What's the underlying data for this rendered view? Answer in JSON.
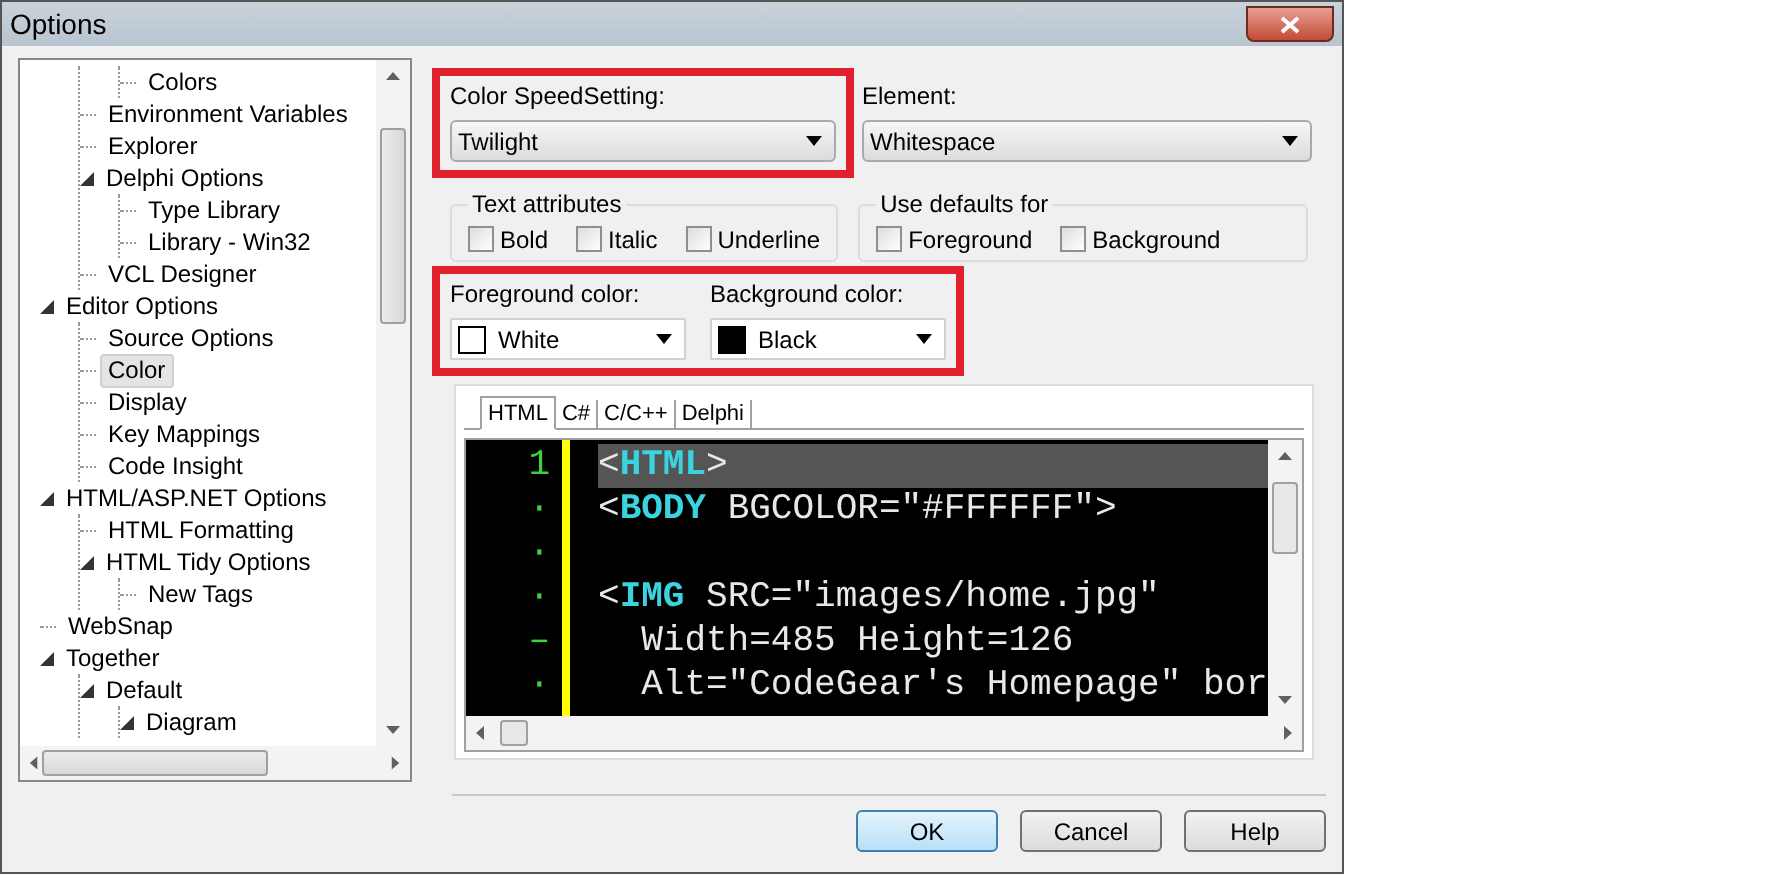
{
  "window": {
    "title": "Options"
  },
  "tree": {
    "items": [
      {
        "children": [
          {
            "children": [
              {
                "label": "Colors",
                "selected": false
              }
            ]
          },
          {
            "label": "Environment Variables",
            "selected": false
          },
          {
            "label": "Explorer",
            "selected": false
          },
          {
            "label": "Delphi Options",
            "selected": false,
            "expanded": true,
            "children": [
              {
                "label": "Type Library",
                "selected": false
              },
              {
                "label": "Library - Win32",
                "selected": false
              }
            ]
          },
          {
            "label": "VCL Designer",
            "selected": false
          }
        ]
      },
      {
        "label": "Editor Options",
        "selected": false,
        "expanded": true,
        "children": [
          {
            "label": "Source Options",
            "selected": false
          },
          {
            "label": "Color",
            "selected": true
          },
          {
            "label": "Display",
            "selected": false
          },
          {
            "label": "Key Mappings",
            "selected": false
          },
          {
            "label": "Code Insight",
            "selected": false
          }
        ]
      },
      {
        "label": "HTML/ASP.NET Options",
        "selected": false,
        "expanded": true,
        "children": [
          {
            "label": "HTML Formatting",
            "selected": false
          },
          {
            "label": "HTML Tidy Options",
            "selected": false,
            "expanded": true,
            "children": [
              {
                "label": "New Tags",
                "selected": false
              }
            ]
          }
        ]
      },
      {
        "label": "WebSnap",
        "selected": false
      },
      {
        "label": "Together",
        "selected": false,
        "expanded": true,
        "children": [
          {
            "label": "Default",
            "selected": false,
            "expanded": true,
            "children": [
              {
                "label": "Diagram",
                "selected": false,
                "expanded": true
              }
            ]
          }
        ]
      }
    ]
  },
  "speed_setting": {
    "label": "Color SpeedSetting:",
    "value": "Twilight",
    "highlighted": true
  },
  "element": {
    "label": "Element:",
    "value": "Whitespace"
  },
  "text_attributes": {
    "title": "Text attributes",
    "options": [
      {
        "label": "Bold",
        "checked": false
      },
      {
        "label": "Italic",
        "checked": false
      },
      {
        "label": "Underline",
        "checked": false
      }
    ]
  },
  "use_defaults": {
    "title": "Use defaults for",
    "options": [
      {
        "label": "Foreground",
        "checked": false
      },
      {
        "label": "Background",
        "checked": false
      }
    ]
  },
  "colors": {
    "highlighted": true,
    "pickers": [
      {
        "label": "Foreground color:",
        "value": "White",
        "color": "#ffffff"
      },
      {
        "label": "Background color:",
        "value": "Black",
        "color": "#000000"
      }
    ]
  },
  "preview": {
    "tabs": [
      {
        "label": "HTML",
        "selected": true
      },
      {
        "label": "C#",
        "selected": false
      },
      {
        "label": "C/C++",
        "selected": false
      },
      {
        "label": "Delphi",
        "selected": false
      }
    ],
    "lines": [
      {
        "gutter": "1",
        "highlighted": true,
        "tokens": [
          {
            "kind": "punct",
            "text": "<"
          },
          {
            "kind": "tag",
            "text": "HTML"
          },
          {
            "kind": "punct",
            "text": ">"
          }
        ]
      },
      {
        "gutter": "·",
        "highlighted": false,
        "tokens": [
          {
            "kind": "punct",
            "text": "<"
          },
          {
            "kind": "tag",
            "text": "BODY"
          },
          {
            "kind": "text",
            "text": " BGCOLOR=\"#FFFFFF\">"
          }
        ]
      },
      {
        "gutter": "·"
      },
      {
        "gutter": "·",
        "highlighted": false,
        "tokens": [
          {
            "kind": "punct",
            "text": "<"
          },
          {
            "kind": "tag",
            "text": "IMG"
          },
          {
            "kind": "text",
            "text": " SRC=\"images/home.jpg\""
          }
        ]
      },
      {
        "gutter": "–",
        "highlighted": false,
        "tokens": [
          {
            "kind": "text",
            "text": "  Width=485 Height=126"
          }
        ]
      },
      {
        "gutter": "·",
        "highlighted": false,
        "tokens": [
          {
            "kind": "text",
            "text": "  Alt=\"CodeGear's Homepage\" bor"
          }
        ]
      }
    ]
  },
  "buttons": [
    {
      "label": "OK",
      "default": true
    },
    {
      "label": "Cancel",
      "default": false
    },
    {
      "label": "Help",
      "default": false
    }
  ]
}
